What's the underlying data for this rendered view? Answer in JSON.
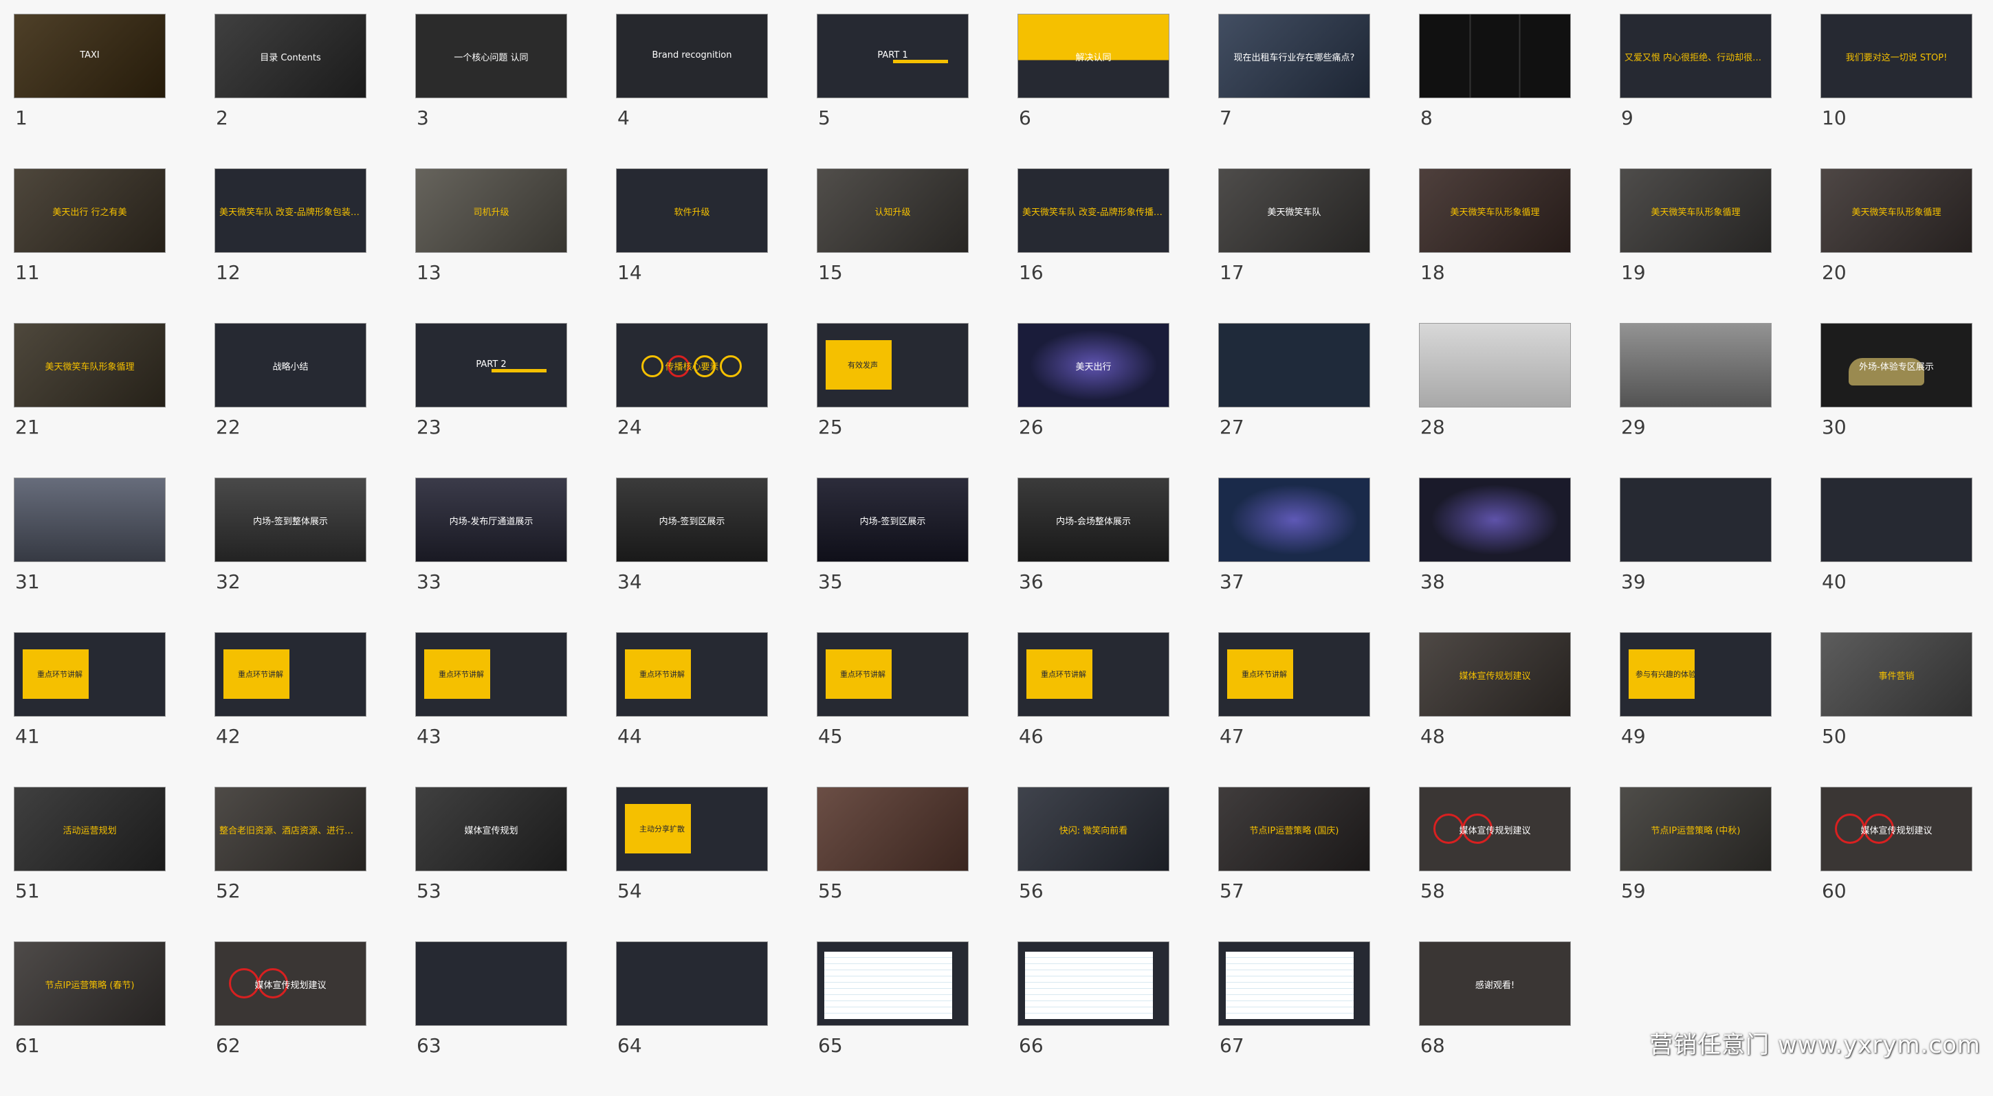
{
  "watermark": "营销任意门 www.yxrym.com",
  "slides": [
    {
      "n": "1",
      "t": "TAXI",
      "bg": "#3a2a10",
      "style": "photo",
      "accent": "#f5c000"
    },
    {
      "n": "2",
      "t": "目录 Contents",
      "bg": "#2a2a2a",
      "style": "photo"
    },
    {
      "n": "3",
      "t": "一个核心问题 认同",
      "bg": "#2b2b2b",
      "style": "dark"
    },
    {
      "n": "4",
      "t": "Brand recognition",
      "bg": "#26282d",
      "style": "brand"
    },
    {
      "n": "5",
      "t": "PART 1",
      "bg": "#262932",
      "style": "part"
    },
    {
      "n": "6",
      "t": "解决认同",
      "bg": "#f5c000",
      "style": "yellow-top"
    },
    {
      "n": "7",
      "t": "现在出租车行业存在哪些痛点?",
      "bg": "#2d3a50",
      "style": "photo"
    },
    {
      "n": "8",
      "t": "",
      "bg": "#1f1f1f",
      "style": "posters"
    },
    {
      "n": "9",
      "t": "又爱又恨 内心很拒绝、行动却很诚实",
      "bg": "#262932",
      "style": "dark-y"
    },
    {
      "n": "10",
      "t": "我们要对这一切说 STOP!",
      "bg": "#262932",
      "style": "dark-y"
    },
    {
      "n": "11",
      "t": "美天出行 行之有美",
      "bg": "#3a3226",
      "style": "photo-y"
    },
    {
      "n": "12",
      "t": "美天微笑车队 改变-品牌形象包装角度",
      "bg": "#262932",
      "style": "dark-y"
    },
    {
      "n": "13",
      "t": "司机升级",
      "bg": "#55524a",
      "style": "photo-y"
    },
    {
      "n": "14",
      "t": "软件升级",
      "bg": "#262932",
      "style": "dark-y"
    },
    {
      "n": "15",
      "t": "认知升级",
      "bg": "#3d3a36",
      "style": "photo-y"
    },
    {
      "n": "16",
      "t": "美天微笑车队 改变-品牌形象传播角度",
      "bg": "#262932",
      "style": "dark-y"
    },
    {
      "n": "17",
      "t": "美天微笑车队",
      "bg": "#3a3836",
      "style": "photo"
    },
    {
      "n": "18",
      "t": "美天微笑车队形象循理",
      "bg": "#3a2a26",
      "style": "photo-y"
    },
    {
      "n": "19",
      "t": "美天微笑车队形象循理",
      "bg": "#3a3836",
      "style": "photo-y"
    },
    {
      "n": "20",
      "t": "美天微笑车队形象循理",
      "bg": "#3a3230",
      "style": "photo-y"
    },
    {
      "n": "21",
      "t": "美天微笑车队形象循理",
      "bg": "#3a3326",
      "style": "photo-y"
    },
    {
      "n": "22",
      "t": "战略小结",
      "bg": "#262932",
      "style": "dark"
    },
    {
      "n": "23",
      "t": "PART 2",
      "bg": "#262932",
      "style": "part"
    },
    {
      "n": "24",
      "t": "传播核心要素",
      "bg": "#262932",
      "style": "sips"
    },
    {
      "n": "25",
      "t": "有效发声",
      "bg": "#262932",
      "style": "yellow-box"
    },
    {
      "n": "26",
      "t": "美天出行",
      "bg": "#1a1c3a",
      "style": "banner"
    },
    {
      "n": "27",
      "t": "",
      "bg": "#1f2a3a",
      "style": "collage"
    },
    {
      "n": "28",
      "t": "",
      "bg": "#c8c8c8",
      "style": "light"
    },
    {
      "n": "29",
      "t": "",
      "bg": "#8a8a8a",
      "style": "stage-day"
    },
    {
      "n": "30",
      "t": "外场-体验专区展示",
      "bg": "#1c1c1c",
      "style": "car"
    },
    {
      "n": "31",
      "t": "",
      "bg": "#5a6070",
      "style": "stage-day"
    },
    {
      "n": "32",
      "t": "内场-签到整体展示",
      "bg": "#3a3a3a",
      "style": "render"
    },
    {
      "n": "33",
      "t": "内场-发布厅通道展示",
      "bg": "#2a2a3a",
      "style": "render"
    },
    {
      "n": "34",
      "t": "内场-签到区展示",
      "bg": "#2a2a2a",
      "style": "render"
    },
    {
      "n": "35",
      "t": "内场-签到区展示",
      "bg": "#1a1a2a",
      "style": "render"
    },
    {
      "n": "36",
      "t": "内场-会场整体展示",
      "bg": "#2a2a2a",
      "style": "render"
    },
    {
      "n": "37",
      "t": "",
      "bg": "#1a2a4a",
      "style": "stage-night"
    },
    {
      "n": "38",
      "t": "",
      "bg": "#1a1a2a",
      "style": "stage-night"
    },
    {
      "n": "39",
      "t": "",
      "bg": "#262932",
      "style": "dark"
    },
    {
      "n": "40",
      "t": "",
      "bg": "#262932",
      "style": "dark"
    },
    {
      "n": "41",
      "t": "重点环节讲解",
      "bg": "#262932",
      "style": "yellow-box"
    },
    {
      "n": "42",
      "t": "重点环节讲解",
      "bg": "#262932",
      "style": "yellow-box"
    },
    {
      "n": "43",
      "t": "重点环节讲解",
      "bg": "#262932",
      "style": "yellow-box"
    },
    {
      "n": "44",
      "t": "重点环节讲解",
      "bg": "#262932",
      "style": "yellow-box"
    },
    {
      "n": "45",
      "t": "重点环节讲解",
      "bg": "#262932",
      "style": "yellow-box"
    },
    {
      "n": "46",
      "t": "重点环节讲解",
      "bg": "#262932",
      "style": "yellow-box"
    },
    {
      "n": "47",
      "t": "重点环节讲解",
      "bg": "#262932",
      "style": "yellow-box"
    },
    {
      "n": "48",
      "t": "媒体宣传规划建议",
      "bg": "#3a3430",
      "style": "photo-y"
    },
    {
      "n": "49",
      "t": "参与有兴趣的体验",
      "bg": "#262932",
      "style": "yellow-box"
    },
    {
      "n": "50",
      "t": "事件营销",
      "bg": "#4a4a4a",
      "style": "photo-y"
    },
    {
      "n": "51",
      "t": "活动运营规划",
      "bg": "#2a2a2a",
      "style": "photo-y"
    },
    {
      "n": "52",
      "t": "整合老旧资源、酒店资源、进行资源整合",
      "bg": "#3a3632",
      "style": "photo-y"
    },
    {
      "n": "53",
      "t": "媒体宣传规划",
      "bg": "#2a2a2a",
      "style": "photo"
    },
    {
      "n": "54",
      "t": "主动分享扩散",
      "bg": "#262932",
      "style": "yellow-box"
    },
    {
      "n": "55",
      "t": "",
      "bg": "#5a3a30",
      "style": "photo"
    },
    {
      "n": "56",
      "t": "快闪: 微笑向前看",
      "bg": "#2a2e38",
      "style": "photo-y"
    },
    {
      "n": "57",
      "t": "节点IP运营策略 (国庆)",
      "bg": "#2a2626",
      "style": "photo-y"
    },
    {
      "n": "58",
      "t": "媒体宣传规划建议",
      "bg": "#3a3634",
      "style": "circles"
    },
    {
      "n": "59",
      "t": "节点IP运营策略 (中秋)",
      "bg": "#3a3834",
      "style": "photo-y"
    },
    {
      "n": "60",
      "t": "媒体宣传规划建议",
      "bg": "#3a3634",
      "style": "circles"
    },
    {
      "n": "61",
      "t": "节点IP运营策略 (春节)",
      "bg": "#3a3634",
      "style": "photo-y"
    },
    {
      "n": "62",
      "t": "媒体宣传规划建议",
      "bg": "#3a3634",
      "style": "circles"
    },
    {
      "n": "63",
      "t": "",
      "bg": "#262932",
      "style": "list"
    },
    {
      "n": "64",
      "t": "",
      "bg": "#262932",
      "style": "list"
    },
    {
      "n": "65",
      "t": "",
      "bg": "#262932",
      "style": "table"
    },
    {
      "n": "66",
      "t": "",
      "bg": "#262932",
      "style": "table"
    },
    {
      "n": "67",
      "t": "",
      "bg": "#262932",
      "style": "table"
    },
    {
      "n": "68",
      "t": "感谢观看!",
      "bg": "#3a3634",
      "style": "end"
    }
  ]
}
